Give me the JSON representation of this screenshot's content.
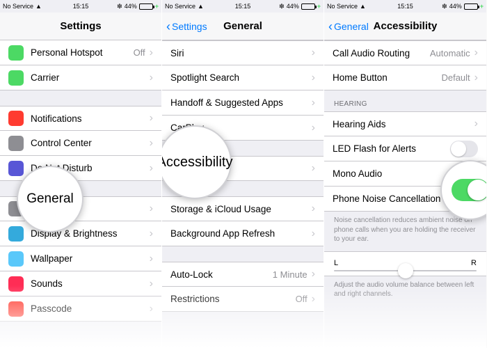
{
  "status": {
    "carrier": "No Service",
    "time": "15:15",
    "battery_pct": "44%"
  },
  "colors": {
    "accent": "#007aff",
    "toggle_on": "#4cd964"
  },
  "screen1": {
    "nav_title": "Settings",
    "rows": {
      "personal_hotspot": {
        "label": "Personal Hotspot",
        "value": "Off"
      },
      "carrier": {
        "label": "Carrier"
      },
      "notifications": {
        "label": "Notifications"
      },
      "control_center": {
        "label": "Control Center"
      },
      "dnd": {
        "label": "Do Not Disturb"
      },
      "general": {
        "label": "General"
      },
      "display": {
        "label": "Display & Brightness"
      },
      "wallpaper": {
        "label": "Wallpaper"
      },
      "sounds": {
        "label": "Sounds"
      },
      "passcode": {
        "label": "Passcode"
      }
    },
    "magnifier": "General"
  },
  "screen2": {
    "back": "Settings",
    "nav_title": "General",
    "rows": {
      "siri": {
        "label": "Siri"
      },
      "spotlight": {
        "label": "Spotlight Search"
      },
      "handoff": {
        "label": "Handoff & Suggested Apps"
      },
      "carplay": {
        "label": "CarPlay"
      },
      "accessibility": {
        "label": "Accessibility"
      },
      "storage": {
        "label": "Storage & iCloud Usage"
      },
      "background_refresh": {
        "label": "Background App Refresh"
      },
      "auto_lock": {
        "label": "Auto-Lock",
        "value": "1 Minute"
      },
      "restrictions": {
        "label": "Restrictions",
        "value": "Off"
      }
    },
    "magnifier": "Accessibility"
  },
  "screen3": {
    "back": "General",
    "nav_title": "Accessibility",
    "rows": {
      "call_audio": {
        "label": "Call Audio Routing",
        "value": "Automatic"
      },
      "home_button": {
        "label": "Home Button",
        "value": "Default"
      }
    },
    "hearing_header": "HEARING",
    "hearing": {
      "hearing_aids": {
        "label": "Hearing Aids"
      },
      "led_flash": {
        "label": "LED Flash for Alerts",
        "on": false
      },
      "mono_audio": {
        "label": "Mono Audio",
        "on": false
      },
      "noise_cancel": {
        "label": "Phone Noise Cancellation",
        "on": true
      }
    },
    "noise_note": "Noise cancellation reduces ambient noise on phone calls when you are holding the receiver to your ear.",
    "slider": {
      "left": "L",
      "right": "R"
    },
    "balance_note": "Adjust the audio volume balance between left and right channels."
  }
}
